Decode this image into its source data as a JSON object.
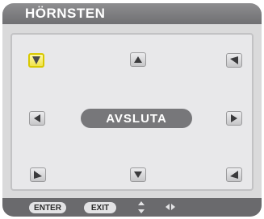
{
  "window": {
    "title": "HÖRNSTEN"
  },
  "grid": {
    "top_left_icon": "arrow-down-right-icon",
    "top_center_icon": "arrow-up-icon",
    "top_right_icon": "arrow-down-left-icon",
    "middle_left_icon": "arrow-left-icon",
    "middle_right_icon": "arrow-right-icon",
    "bottom_left_icon": "arrow-up-right-icon",
    "bottom_center_icon": "arrow-down-icon",
    "bottom_right_icon": "arrow-up-left-icon",
    "exit_button_label": "AVSLUTA",
    "selected": "top_left"
  },
  "footer": {
    "enter_label": "ENTER",
    "exit_label": "EXIT",
    "updown_icon": "up-down-arrows-icon",
    "leftright_icon": "left-right-arrows-icon"
  },
  "colors": {
    "titlebar": "#7d7d80",
    "panel": "#e8e8ea",
    "selected": "#f1e34a",
    "footer": "#6a6a6d"
  }
}
